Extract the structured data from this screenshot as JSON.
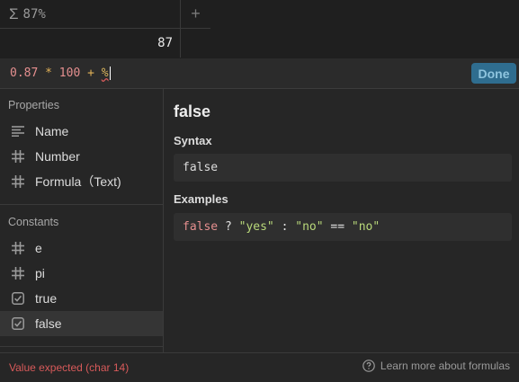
{
  "table": {
    "column_icon": "sigma-icon",
    "column_title": "87%",
    "add_column_icon": "plus-icon",
    "add_column_symbol": "+",
    "cell_value": "87"
  },
  "formula_bar": {
    "num1": "0.87",
    "op1": "*",
    "num2": "100",
    "op2": "+",
    "err_token": "%",
    "done_label": "Done"
  },
  "sidebar": {
    "properties_title": "Properties",
    "properties": [
      {
        "label": "Name",
        "icon": "text-lines-icon"
      },
      {
        "label": "Number",
        "icon": "hash-icon"
      },
      {
        "label": "Formula（Text)",
        "icon": "hash-icon"
      }
    ],
    "constants_title": "Constants",
    "constants": [
      {
        "label": "e",
        "icon": "hash-icon"
      },
      {
        "label": "pi",
        "icon": "hash-icon"
      },
      {
        "label": "true",
        "icon": "checkbox-icon"
      },
      {
        "label": "false",
        "icon": "checkbox-icon",
        "selected": true
      }
    ]
  },
  "detail": {
    "title": "false",
    "syntax_heading": "Syntax",
    "syntax_code": "false",
    "examples_heading": "Examples",
    "example": {
      "kw": "false",
      "q": " ? ",
      "s1": "\"yes\"",
      "colon": " : ",
      "s2": "\"no\"",
      "eq": " == ",
      "s3": "\"no\""
    }
  },
  "footer": {
    "error": "Value expected (char 14)",
    "learn_more": "Learn more about formulas",
    "help_icon": "question-circle-icon"
  },
  "colors": {
    "background": "#262626",
    "accent_button": "#2f6d8f",
    "error": "#d85a5a",
    "keyword": "#e58f8f",
    "string": "#b9d97a"
  }
}
